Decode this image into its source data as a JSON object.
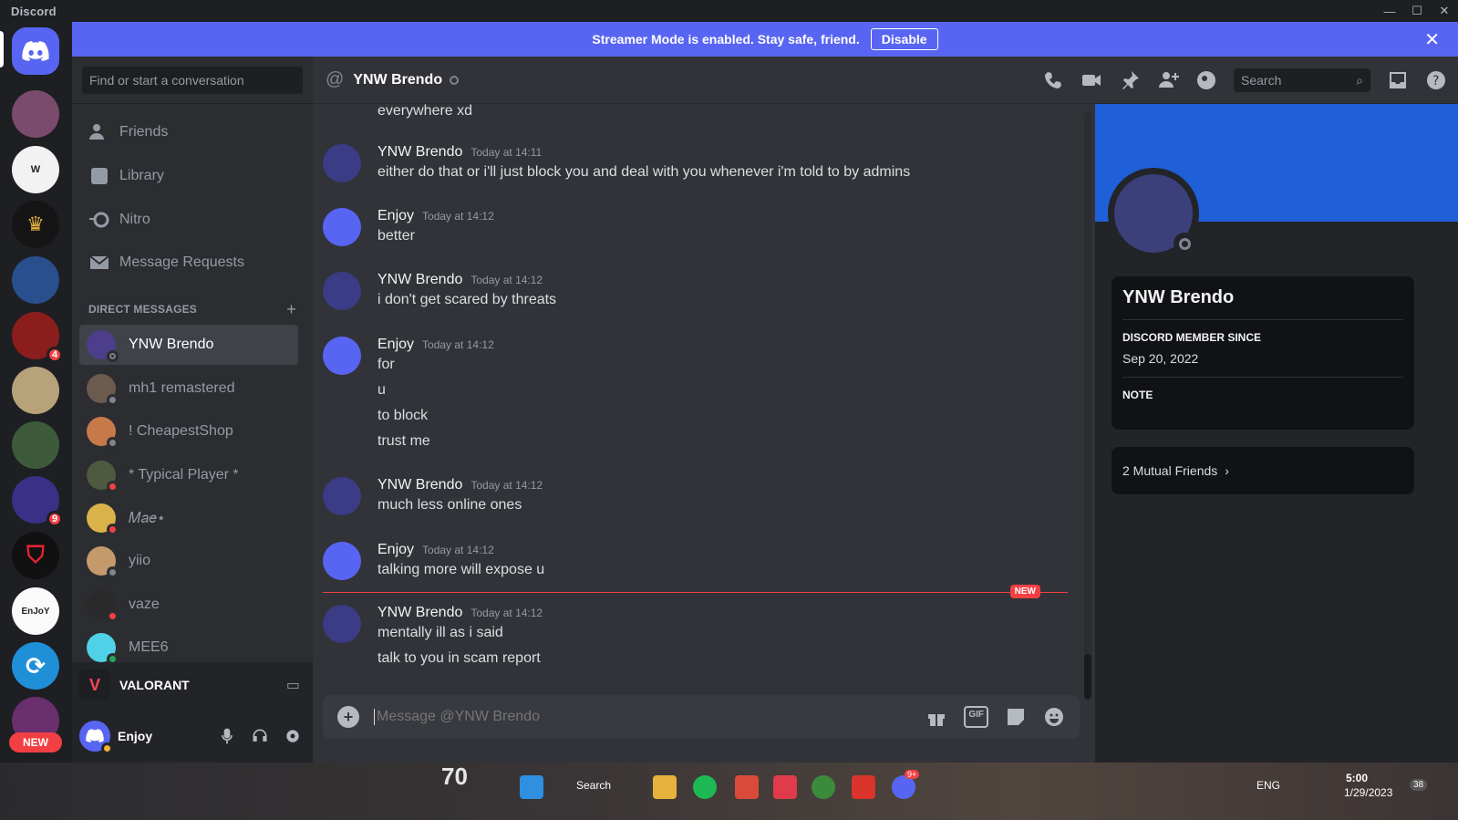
{
  "window": {
    "app_name": "Discord"
  },
  "banner": {
    "text": "Streamer Mode is enabled. Stay safe, friend.",
    "button": "Disable"
  },
  "guilds": {
    "badges": [
      "4",
      "9"
    ],
    "new_label": "NEW"
  },
  "sidebar": {
    "search_placeholder": "Find or start a conversation",
    "nav": [
      {
        "label": "Friends",
        "icon": "friends-icon"
      },
      {
        "label": "Library",
        "icon": "library-icon"
      },
      {
        "label": "Nitro",
        "icon": "nitro-icon"
      },
      {
        "label": "Message Requests",
        "icon": "envelope-icon"
      }
    ],
    "dm_header": "DIRECT MESSAGES",
    "dms": [
      {
        "name": "YNW Brendo",
        "status": "offline"
      },
      {
        "name": "mh1 remastered",
        "status": "idle"
      },
      {
        "name": "! CheapestShop",
        "status": "idle"
      },
      {
        "name": "* Typical Player *",
        "status": "dnd"
      },
      {
        "name": "𝑀𝑎𝑒⋆",
        "status": "dnd"
      },
      {
        "name": "yiio",
        "status": "idle"
      },
      {
        "name": "vaze",
        "status": "dnd"
      },
      {
        "name": "MEE6",
        "status": "online"
      }
    ],
    "activity": {
      "game": "VALORANT"
    },
    "user": {
      "name": "Enjoy"
    }
  },
  "chat": {
    "recipient": "YNW Brendo",
    "search_placeholder": "Search",
    "composer_placeholder": "Message @YNW Brendo",
    "gif_label": "GIF",
    "new_tag": "NEW",
    "top_fragment": "everywhere xd",
    "messages": [
      {
        "author": "YNW Brendo",
        "time": "Today at 14:11",
        "lines": [
          "either do that or i'll just block you and deal with you whenever i'm told to by admins"
        ]
      },
      {
        "author": "Enjoy",
        "time": "Today at 14:12",
        "lines": [
          "better"
        ]
      },
      {
        "author": "YNW Brendo",
        "time": "Today at 14:12",
        "lines": [
          "i don't get scared by threats"
        ]
      },
      {
        "author": "Enjoy",
        "time": "Today at 14:12",
        "lines": [
          "for",
          "u",
          "to block",
          "trust me"
        ]
      },
      {
        "author": "YNW Brendo",
        "time": "Today at 14:12",
        "lines": [
          "much less online ones"
        ]
      },
      {
        "author": "Enjoy",
        "time": "Today at 14:12",
        "lines": [
          "talking more will expose u"
        ]
      },
      {
        "author": "YNW Brendo",
        "time": "Today at 14:12",
        "lines": [
          "mentally ill as i said",
          "talk to you in scam report"
        ]
      }
    ]
  },
  "profile": {
    "name": "YNW Brendo",
    "member_since_label": "DISCORD MEMBER SINCE",
    "member_since": "Sep 20, 2022",
    "note_label": "NOTE",
    "mutual_friends": "2 Mutual Friends"
  },
  "taskbar": {
    "search": "Search",
    "hud_number": "70",
    "lang": "ENG",
    "time": "5:00",
    "date": "1/29/2023",
    "notif": "9+",
    "corner": "38"
  },
  "colors": {
    "blurple": "#5865f2",
    "profile_banner": "#1f5fd7",
    "dnd": "#f23f43",
    "online": "#23a55a",
    "idle": "#f0b232"
  }
}
